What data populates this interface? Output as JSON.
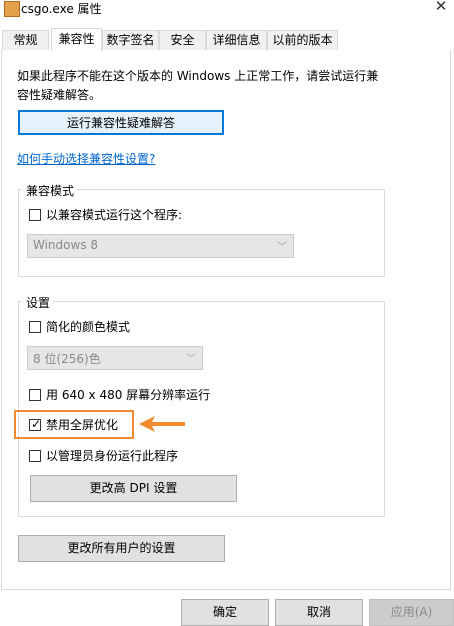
{
  "window": {
    "title": "csgo.exe 属性",
    "close_glyph": "✕"
  },
  "tabs": [
    {
      "label": "常规",
      "active": false
    },
    {
      "label": "兼容性",
      "active": true
    },
    {
      "label": "数字签名",
      "active": false
    },
    {
      "label": "安全",
      "active": false
    },
    {
      "label": "详细信息",
      "active": false
    },
    {
      "label": "以前的版本",
      "active": false
    }
  ],
  "intro": {
    "line1": "如果此程序不能在这个版本的 Windows 上正常工作，请尝试运行兼",
    "line2": "容性疑难解答。"
  },
  "troubleshooter_button": "运行兼容性疑难解答",
  "manual_link": "如何手动选择兼容性设置?",
  "compat_mode": {
    "group_label": "兼容模式",
    "checkbox_label": "以兼容模式运行这个程序:",
    "checked": false,
    "os_select_value": "Windows 8"
  },
  "settings": {
    "group_label": "设置",
    "reduced_color": {
      "label": "简化的颜色模式",
      "checked": false
    },
    "color_select_value": "8 位(256)色",
    "low_res": {
      "label": "用 640 x 480 屏幕分辨率运行",
      "checked": false
    },
    "disable_fullscreen": {
      "label": "禁用全屏优化",
      "checked": true
    },
    "run_as_admin": {
      "label": "以管理员身份运行此程序",
      "checked": false
    },
    "dpi_button": "更改高 DPI 设置"
  },
  "all_users_button": "更改所有用户的设置",
  "footer": {
    "ok": "确定",
    "cancel": "取消",
    "apply": "应用(A)"
  },
  "colors": {
    "accent": "#0078d7",
    "highlight": "#ef8b2c",
    "link": "#0066cc"
  },
  "icons": {
    "app": "csgo-app-icon",
    "close": "close-icon",
    "arrow": "left-arrow-annotation-icon",
    "check": "checkmark-icon"
  }
}
